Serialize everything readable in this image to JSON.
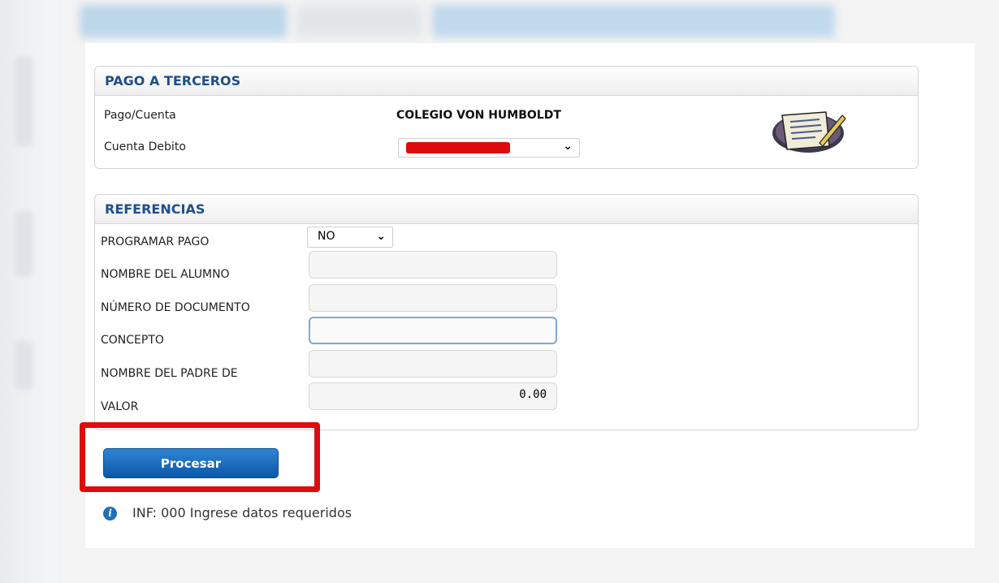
{
  "pago": {
    "title": "PAGO A TERCEROS",
    "pago_cuenta_label": "Pago/Cuenta",
    "pago_cuenta_value": "COLEGIO VON HUMBOLDT",
    "cuenta_debito_label": "Cuenta Debito",
    "cuenta_debito_value": "",
    "icon": "scroll-quill-icon"
  },
  "referencias": {
    "title": "REFERENCIAS",
    "programar_label": "PROGRAMAR PAGO",
    "programar_value": "NO",
    "nombre_alumno_label": "NOMBRE DEL ALUMNO",
    "nombre_alumno_value": "",
    "documento_label": "NÚMERO DE DOCUMENTO",
    "documento_value": "",
    "concepto_label": "CONCEPTO",
    "concepto_value": "",
    "padre_label": "NOMBRE DEL PADRE DE",
    "padre_value": "",
    "valor_label": "VALOR",
    "valor_value": "0.00"
  },
  "actions": {
    "procesar_label": "Procesar"
  },
  "status": {
    "message": "INF: 000 Ingrese datos requeridos",
    "icon": "info-icon"
  },
  "colors": {
    "header_text": "#1e4f8a",
    "button": "#0b57a8",
    "highlight": "#dd0d0d"
  }
}
